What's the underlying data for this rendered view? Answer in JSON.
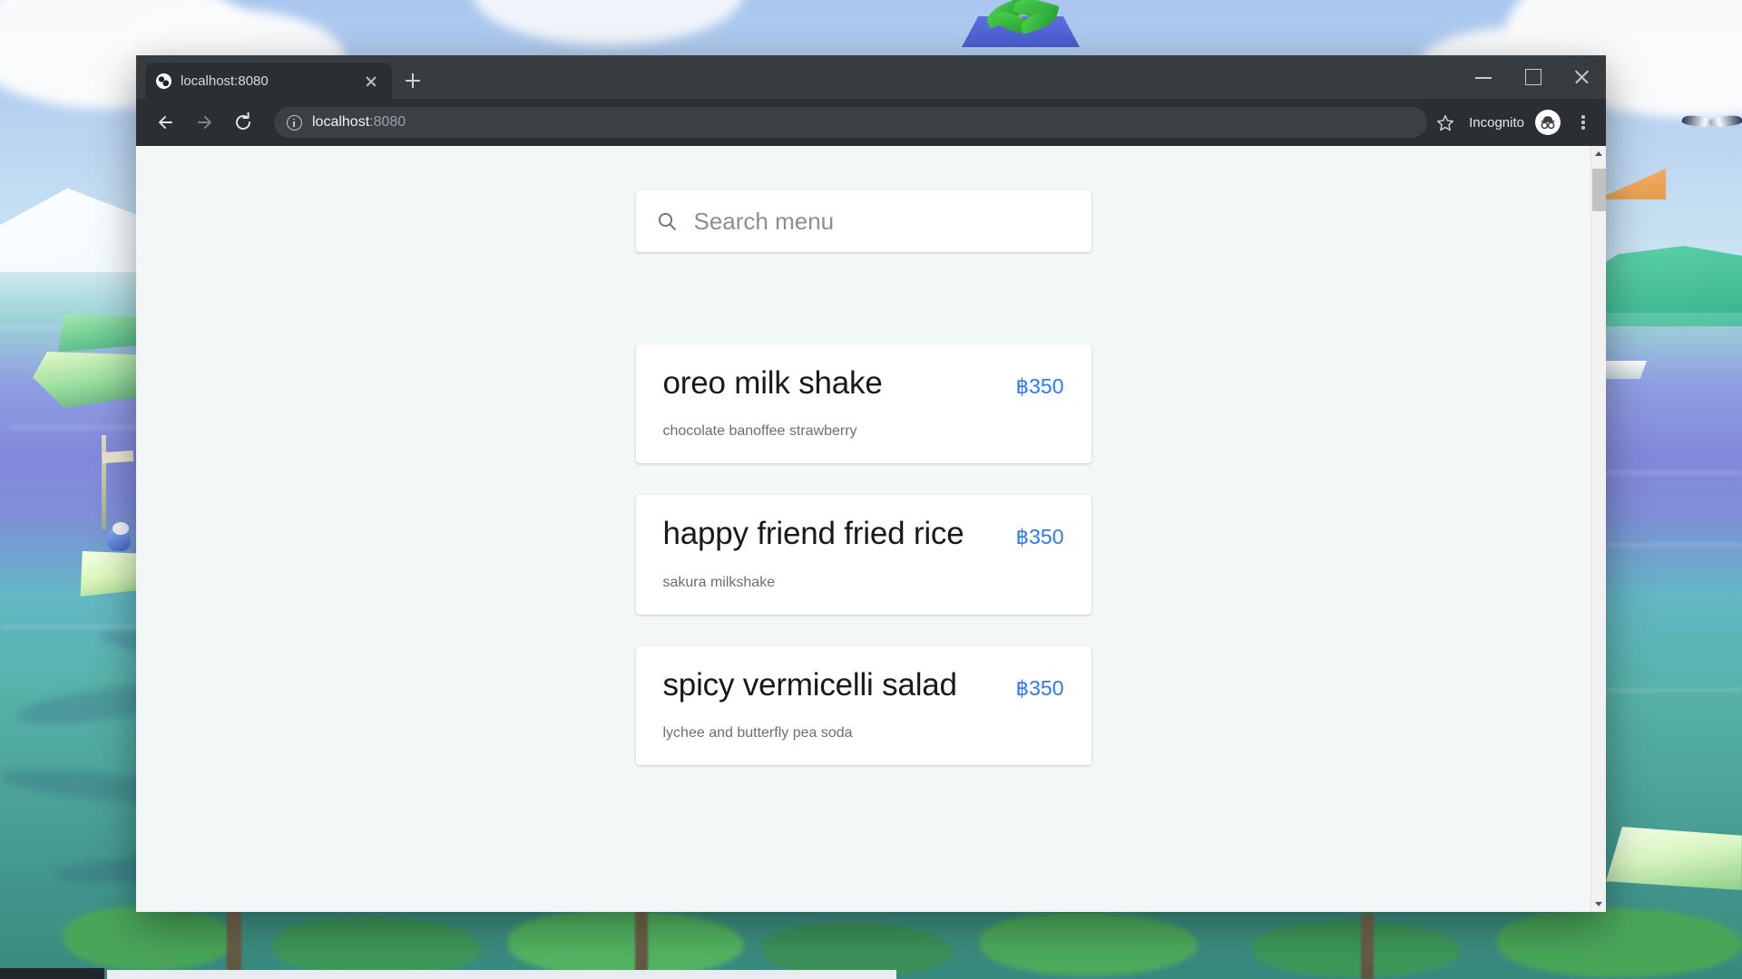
{
  "browser": {
    "tab": {
      "title": "localhost:8080",
      "favicon": "globe-icon"
    },
    "newtab_label": "+",
    "address": {
      "host": "localhost",
      "port": ":8080",
      "security_icon": "info-circle-icon"
    },
    "profile": {
      "label": "Incognito",
      "avatar": "incognito-hat-glasses-icon"
    },
    "window_controls": {
      "minimize": "minimize-icon",
      "maximize": "maximize-icon",
      "close": "close-icon"
    },
    "nav": {
      "back": "back-arrow-icon",
      "forward": "forward-arrow-icon",
      "reload": "reload-icon"
    },
    "bookmark_icon": "star-icon",
    "menu_icon": "three-dots-icon"
  },
  "page": {
    "search": {
      "placeholder": "Search menu",
      "value": "",
      "icon": "search-icon"
    },
    "currency_symbol": "฿",
    "accent_color": "#2979ff",
    "items": [
      {
        "name": "oreo milk shake",
        "price": "฿350",
        "description": "chocolate banoffee strawberry"
      },
      {
        "name": "happy friend fried rice",
        "price": "฿350",
        "description": "sakura milkshake"
      },
      {
        "name": "spicy vermicelli salad",
        "price": "฿350",
        "description": "lychee and butterfly pea soda"
      }
    ]
  },
  "scrollbar": {
    "up_arrow": "scroll-up-icon",
    "down_arrow": "scroll-down-icon"
  }
}
